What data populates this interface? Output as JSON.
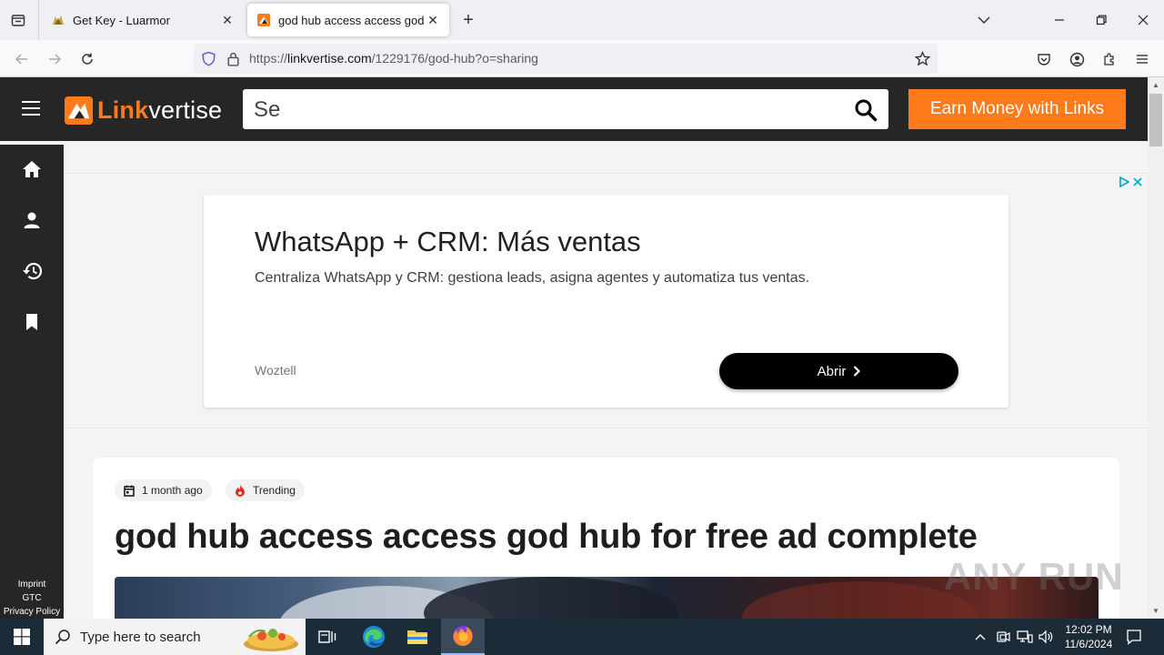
{
  "browser": {
    "tabs": [
      {
        "title": "Get Key - Luarmor",
        "active": false
      },
      {
        "title": "god hub access access god hub for free ad complete",
        "active": true
      }
    ],
    "url_prefix": "https://",
    "url_domain": "linkvertise.com",
    "url_path": "/1229176/god-hub?o=sharing"
  },
  "header": {
    "logo_part1": "Link",
    "logo_part2": "vertise",
    "search_value": "Se",
    "earn_button": "Earn Money with Links"
  },
  "sidebar": {
    "items": [
      {
        "icon": "home-icon"
      },
      {
        "icon": "user-icon"
      },
      {
        "icon": "history-icon"
      },
      {
        "icon": "bookmark-icon"
      }
    ],
    "links": [
      "Imprint",
      "GTC",
      "Privacy Policy"
    ]
  },
  "ad": {
    "title": "WhatsApp + CRM: Más ventas",
    "description": "Centraliza WhatsApp y CRM: gestiona leads, asigna agentes y automatiza tus ventas.",
    "brand": "Woztell",
    "button": "Abrir"
  },
  "article": {
    "date_chip": "1 month ago",
    "trending_chip": "Trending",
    "title": "god hub access access god hub for free ad complete"
  },
  "watermark": "ANY RUN",
  "taskbar": {
    "search_placeholder": "Type here to search",
    "time": "12:02 PM",
    "date": "11/6/2024"
  },
  "colors": {
    "accent": "#ff7a1a",
    "header_bg": "#262626"
  }
}
